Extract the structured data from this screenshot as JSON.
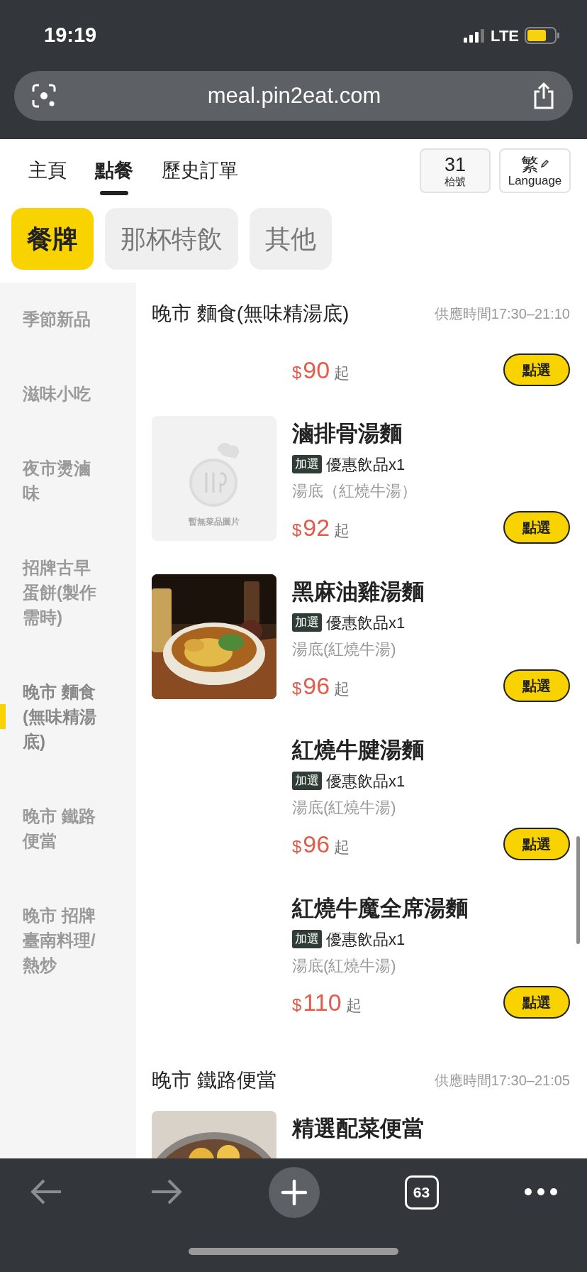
{
  "status_bar": {
    "time": "19:19",
    "network": "LTE"
  },
  "browser": {
    "url": "meal.pin2eat.com",
    "tab_count": "63"
  },
  "nav_tabs": [
    {
      "label": "主頁",
      "selected": false
    },
    {
      "label": "點餐",
      "selected": true
    },
    {
      "label": "歷史訂單",
      "selected": false
    }
  ],
  "table_number": {
    "value": "31",
    "label": "枱號"
  },
  "language": {
    "value": "繁",
    "label": "Language"
  },
  "categories": [
    {
      "label": "餐牌",
      "selected": true
    },
    {
      "label": "那杯特飲",
      "selected": false
    },
    {
      "label": "其他",
      "selected": false
    }
  ],
  "sidebar": {
    "items": [
      {
        "label": "季節新品",
        "selected": false
      },
      {
        "label": "滋味小吃",
        "selected": false
      },
      {
        "label": "夜市燙滷味",
        "selected": false
      },
      {
        "label": "招牌古早蛋餅(製作需時)",
        "selected": false
      },
      {
        "label": "晚市 麵食(無味精湯底)",
        "selected": true
      },
      {
        "label": "晚市 鐵路便當",
        "selected": false
      },
      {
        "label": "晚市 招牌臺南料理/熱炒",
        "selected": false
      }
    ]
  },
  "sections": [
    {
      "title": "晚市 麵食(無味精湯底)",
      "hours": "供應時間17:30–21:10",
      "items": [
        {
          "kind": "partial",
          "currency": "$",
          "price": "90",
          "suffix": "起",
          "button": "點選"
        },
        {
          "kind": "full",
          "image_text": "暫無菜品圖片",
          "name": "滷排骨湯麵",
          "tag": "加選",
          "extra": "優惠飲品x1",
          "broth": "湯底（紅燒牛湯）",
          "currency": "$",
          "price": "92",
          "suffix": "起",
          "button": "點選"
        },
        {
          "kind": "full",
          "photo": true,
          "name": "黑麻油雞湯麵",
          "tag": "加選",
          "extra": "優惠飲品x1",
          "broth": "湯底(紅燒牛湯)",
          "currency": "$",
          "price": "96",
          "suffix": "起",
          "button": "點選"
        },
        {
          "kind": "full",
          "name": "紅燒牛腱湯麵",
          "tag": "加選",
          "extra": "優惠飲品x1",
          "broth": "湯底(紅燒牛湯)",
          "currency": "$",
          "price": "96",
          "suffix": "起",
          "button": "點選"
        },
        {
          "kind": "full",
          "name": "紅燒牛魔全席湯麵",
          "tag": "加選",
          "extra": "優惠飲品x1",
          "broth": "湯底(紅燒牛湯)",
          "currency": "$",
          "price": "110",
          "suffix": "起",
          "button": "點選"
        }
      ]
    },
    {
      "title": "晚市 鐵路便當",
      "hours": "供應時間17:30–21:05",
      "items": [
        {
          "kind": "full",
          "photo": true,
          "name": "精選配菜便當"
        }
      ]
    }
  ]
}
